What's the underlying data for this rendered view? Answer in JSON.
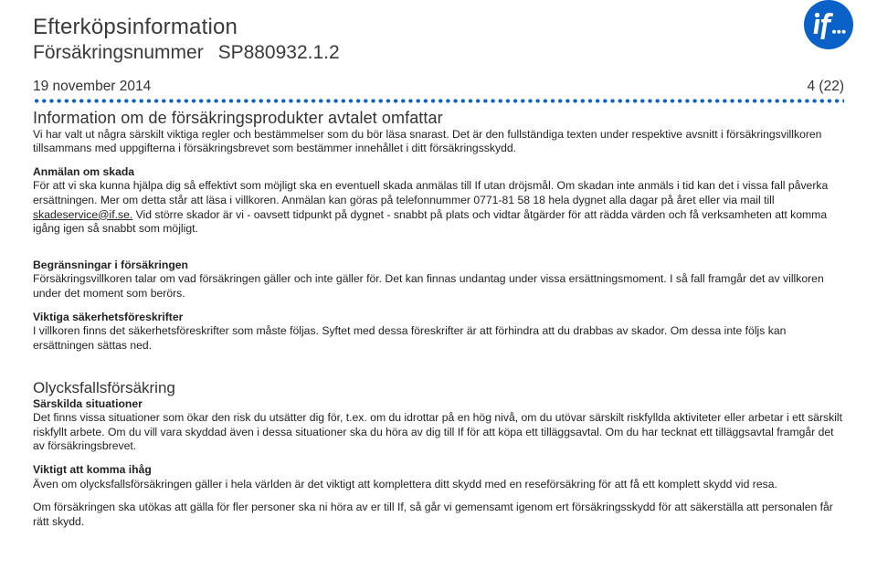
{
  "header": {
    "title": "Efterköpsinformation",
    "insurance_label": "Försäkringsnummer",
    "insurance_number": "SP880932.1.2",
    "date": "19 november 2014",
    "page_indicator": "4 (22)"
  },
  "logo": {
    "name": "if-logo"
  },
  "s1": {
    "title": "Information om de försäkringsprodukter avtalet omfattar",
    "intro": "Vi har valt ut några särskilt viktiga regler och bestämmelser som du bör läsa snarast. Det är den fullständiga texten under respektive avsnitt i försäkringsvillkoren tillsammans med uppgifterna i försäkringsbrevet som bestämmer innehållet i ditt försäkringsskydd.",
    "anmalan_h": "Anmälan om skada",
    "anmalan_b_before": "För att vi ska kunna hjälpa dig så effektivt som möjligt ska en eventuell skada anmälas till If utan dröjsmål. Om skadan inte anmäls i tid kan det i vissa fall påverka ersättningen. Mer om detta står att läsa i villkoren. Anmälan kan göras på telefonnummer 0771-81 58 18 hela dygnet alla dagar på året eller via mail till ",
    "anmalan_email": "skadeservice@if.se.",
    "anmalan_b_after": " Vid större skador är vi - oavsett tidpunkt på dygnet - snabbt på plats och vidtar åtgärder för att rädda värden och få verksamheten att komma igång igen så snabbt som möjligt.",
    "begr_h": "Begränsningar i försäkringen",
    "begr_b": "Försäkringsvillkoren talar om vad försäkringen gäller och inte gäller för. Det kan finnas undantag under vissa ersättningsmoment. I så fall framgår det av villkoren under det moment som berörs.",
    "vikt_h": "Viktiga säkerhetsföreskrifter",
    "vikt_b": "I villkoren finns det säkerhetsföreskrifter som måste följas. Syftet med dessa föreskrifter är att förhindra att du drabbas av skador. Om dessa inte följs kan ersättningen sättas ned."
  },
  "s2": {
    "title": "Olycksfallsförsäkring",
    "sit_h": "Särskilda situationer",
    "sit_b": "Det finns vissa situationer som ökar den risk du utsätter dig för, t.ex. om du idrottar på en hög nivå, om du utövar särskilt riskfyllda aktiviteter eller arbetar i ett särskilt riskfyllt arbete. Om du vill vara skyddad även i dessa situationer ska du höra av dig till If för att köpa ett tilläggsavtal. Om du har tecknat ett tilläggsavtal framgår det av försäkringsbrevet.",
    "ihag_h": "Viktigt att komma ihåg",
    "ihag_b": "Även om olycksfallsförsäkringen gäller i hela världen är det viktigt att komplettera ditt skydd med en reseförsäkring för att få ett komplett skydd vid resa.",
    "utokas_b": "Om försäkringen ska utökas att gälla för fler personer ska ni höra av er till If, så går vi gemensamt igenom ert försäkringsskydd för att säkerställa att personalen får rätt skydd."
  }
}
